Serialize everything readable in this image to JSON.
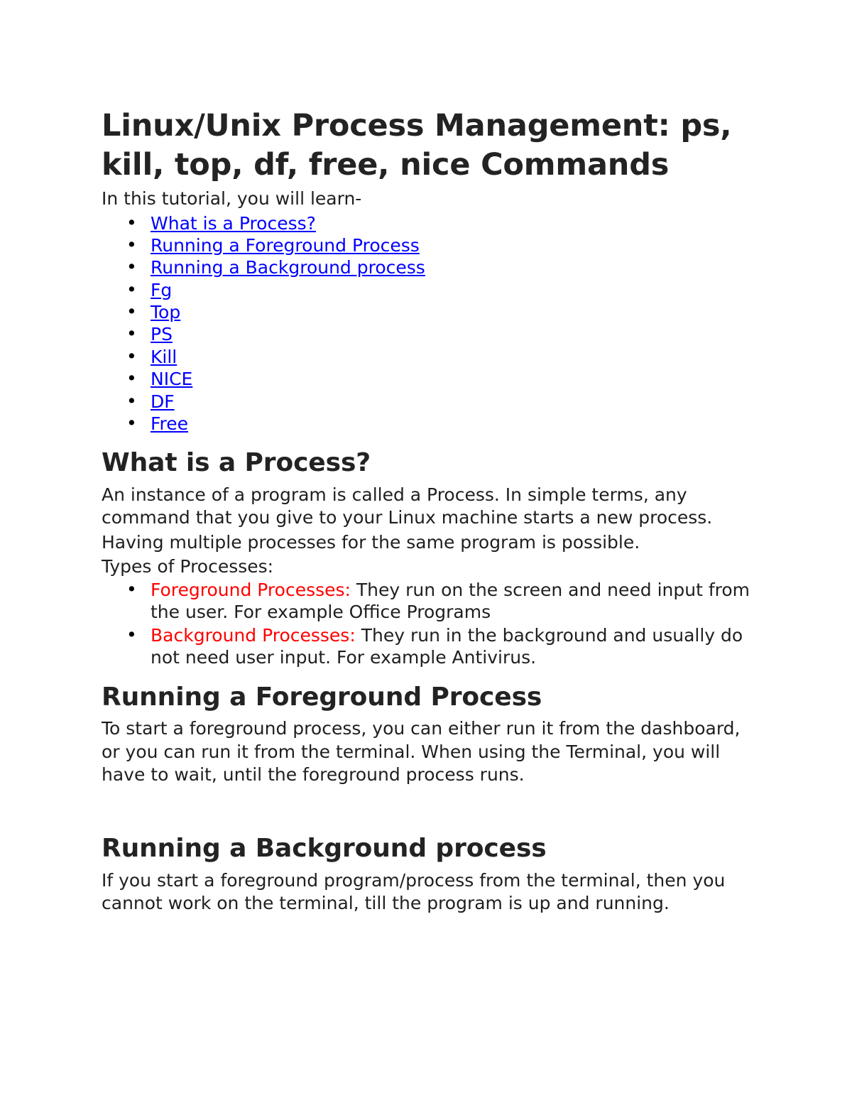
{
  "document": {
    "title": "Linux/Unix Process Management: ps, kill, top, df, free, nice Commands",
    "intro_line": "In this tutorial, you will learn-",
    "colors": {
      "link": "#0000FF",
      "highlight": "#FF0000",
      "heading": "#232323",
      "body": "#1F1F1F",
      "background": "#FFFFFF"
    },
    "toc": [
      {
        "label": "What is a Process?"
      },
      {
        "label": "Running a Foreground Process"
      },
      {
        "label": "Running a Background process"
      },
      {
        "label": "Fg"
      },
      {
        "label": "Top"
      },
      {
        "label": "PS"
      },
      {
        "label": "Kill"
      },
      {
        "label": "NICE"
      },
      {
        "label": "DF"
      },
      {
        "label": "Free"
      }
    ],
    "sections": [
      {
        "heading": "What is a Process?",
        "paragraphs": [
          "An instance of a program is called a Process. In simple terms, any command that you give to your Linux machine starts a new process.",
          "Having multiple processes for the same program is possible.",
          "Types of Processes:"
        ],
        "types": [
          {
            "label": "Foreground Processes:",
            "text": " They run on the screen and need input from the user. For example Office Programs"
          },
          {
            "label": "Background Processes:",
            "text": " They run in the background and usually do not need user input. For example Antivirus."
          }
        ]
      },
      {
        "heading": "Running a Foreground Process",
        "paragraphs": [
          "To start a foreground process, you can either run it from the dashboard, or you can run it from the terminal. When using the Terminal, you will have to wait, until the foreground process runs."
        ]
      },
      {
        "heading": "Running a Background process",
        "paragraphs": [
          "If you start a foreground program/process from the terminal, then you cannot work on the terminal, till the program is up and running."
        ]
      }
    ]
  }
}
